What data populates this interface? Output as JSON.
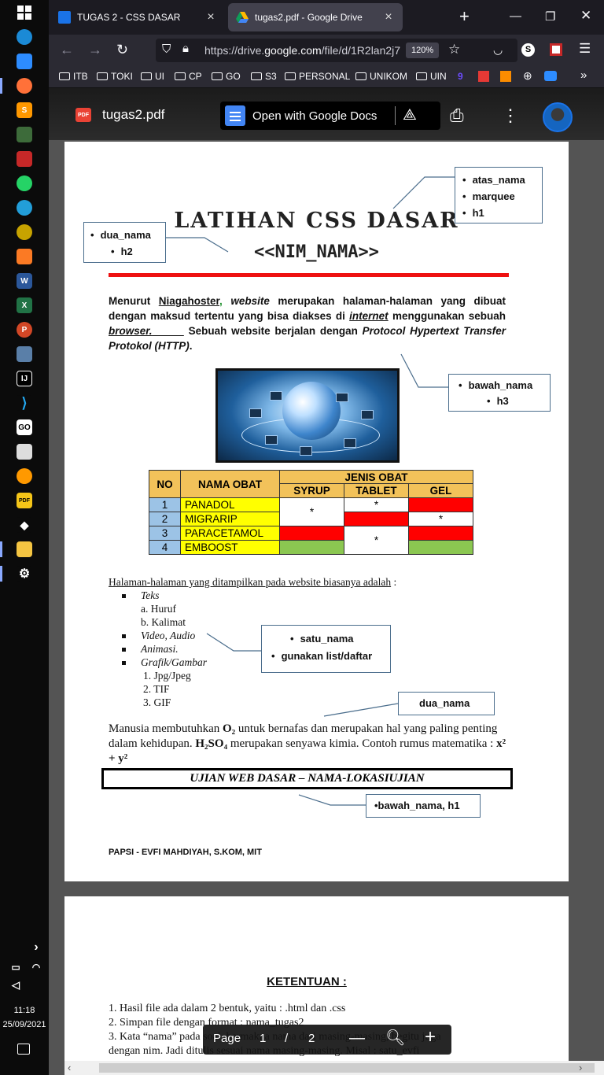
{
  "taskbar": {
    "time": "11:18",
    "date": "25/09/2021",
    "apps": [
      "windows-start",
      "edge",
      "zoom",
      "firefox",
      "sublime",
      "camtasia",
      "wondershare",
      "whatsapp",
      "telegram",
      "chrome-canary",
      "xampp",
      "word",
      "excel",
      "powerpoint",
      "virtualbox",
      "intellij",
      "vscode",
      "go",
      "app-center",
      "aws",
      "pdf",
      "inkscape",
      "file-explorer",
      "settings"
    ]
  },
  "browser": {
    "tabs": [
      {
        "title": "TUGAS 2 - CSS DASAR",
        "active": false
      },
      {
        "title": "tugas2.pdf - Google Drive",
        "active": true
      }
    ],
    "url_prefix": "https://drive.",
    "url_domain": "google.com",
    "url_rest": "/file/d/1R2lan2j7",
    "zoom": "120%",
    "bookmarks": [
      "ITB",
      "TOKI",
      "UI",
      "CP",
      "GO",
      "S3",
      "PERSONAL",
      "UNIKOM",
      "UIN"
    ]
  },
  "viewer": {
    "file_name": "tugas2.pdf",
    "open_with": "Open with Google Docs",
    "page_label": "Page",
    "page_current": "1",
    "page_sep": "/",
    "page_total": "2"
  },
  "doc": {
    "title1": "LATIHAN CSS DASAR",
    "title2": "<<NIM_NAMA>>",
    "callouts": {
      "atas": [
        "atas_nama",
        "marquee",
        "h1"
      ],
      "dua": [
        "dua_nama",
        "h2"
      ],
      "bawah": [
        "bawah_nama",
        "h3"
      ],
      "satu": [
        "satu_nama",
        "gunakan list/daftar"
      ],
      "dua_nama2": "dua_nama",
      "bawah_h1": "•bawah_nama, h1"
    },
    "para1": {
      "t1": "Menurut ",
      "niagahoster": "Niagahoster",
      "comma": ",",
      "website": " website",
      "t2": " merupakan halaman-halaman yang dibuat dengan maksud tertentu yang bisa diakses di ",
      "internet": "internet",
      "t3": " menggunakan sebuah ",
      "browser": "browser.",
      "t4": "      Sebuah website berjalan dengan ",
      "protocol": "Protocol Hypertext Transfer Protokol (HTTP)",
      "t5": "."
    },
    "table": {
      "h_no": "NO",
      "h_nama": "NAMA OBAT",
      "h_jenis": "JENIS OBAT",
      "h_syrup": "SYRUP",
      "h_tablet": "TABLET",
      "h_gel": "GEL",
      "rows": [
        {
          "no": "1",
          "nama": "PANADOL"
        },
        {
          "no": "2",
          "nama": "MIGRARIP"
        },
        {
          "no": "3",
          "nama": "PARACETAMOL"
        },
        {
          "no": "4",
          "nama": "EMBOOST"
        }
      ],
      "star": "*",
      "colors": {
        "header": "#f2c25a",
        "no": "#9cc3e6",
        "name": "#ffff00",
        "red": "#ff0000",
        "green": "#8bc751"
      }
    },
    "list": {
      "intro": "Halaman-halaman yang ditampilkan pada website biasanya adalah",
      "intro_tail": " :",
      "items": [
        "Teks",
        "Video, Audio",
        "Animasi.",
        "Grafik/Gambar"
      ],
      "teks_sub": [
        "a.  Huruf",
        "b.  Kalimat"
      ],
      "grafik_sub": [
        "1.  Jpg/Jpeg",
        "2.  TIF",
        "3.  GIF"
      ]
    },
    "para2": {
      "t1": "Manusia membutuhkan ",
      "o2": "O₂",
      "t2": " untuk bernafas dan merupakan hal yang paling penting dalam kehidupan. ",
      "h2so4": "H₂SO₄",
      "t3": " merupakan senyawa kimia. Contoh rumus matematika : ",
      "math": "x² + y²"
    },
    "boxed": "UJIAN WEB DASAR – NAMA-LOKASIUJIAN",
    "footer": "PAPSI - EVFI MAHDIYAH, S.KOM, MIT",
    "page2": {
      "title": "KETENTUAN :",
      "items": [
        "1.   Hasil file ada dalam 2 bentuk, yaitu : .html dan .css",
        "2.   Simpan file dengan format : nama_tugas2",
        "3.   Kata “nama” pada soal, bermakna nama dari masing-masing, begitu juga",
        "       dengan nim. Jadi ditulis sesuai nama masing-masing. Misal : satu_evfi"
      ]
    }
  }
}
